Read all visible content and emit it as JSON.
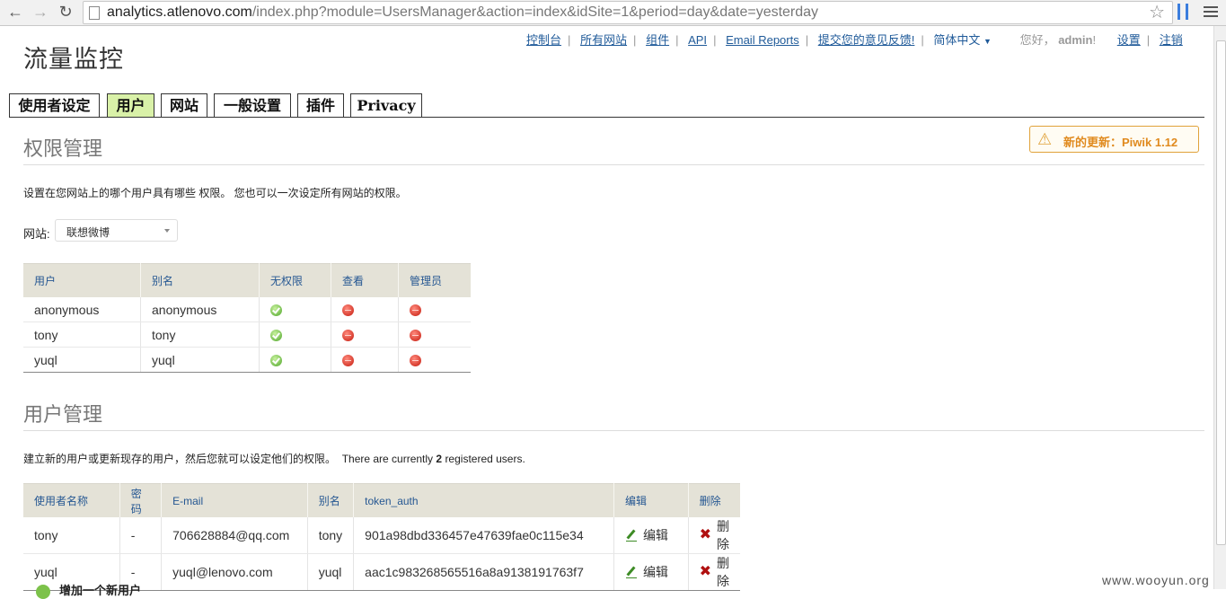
{
  "browser": {
    "back_icon": "back-arrow-icon",
    "forward_icon": "forward-arrow-icon",
    "reload_icon": "reload-icon",
    "url_host": "analytics.atlenovo.com",
    "url_path": "/index.php?module=UsersManager&action=index&idSite=1&period=day&date=yesterday"
  },
  "header": {
    "logo": "流量监控",
    "nav": [
      "控制台",
      "所有网站",
      "组件",
      "API",
      "Email Reports",
      "提交您的意见反馈!"
    ],
    "language": "简体中文",
    "greeting_prefix": "您好，",
    "username": "admin",
    "greeting_suffix": "!",
    "settings": "设置",
    "logout": "注销"
  },
  "tabs": [
    {
      "label": "使用者设定",
      "active": false
    },
    {
      "label": "用户",
      "active": true
    },
    {
      "label": "网站",
      "active": false
    },
    {
      "label": "一般设置",
      "active": false
    },
    {
      "label": "插件",
      "active": false
    },
    {
      "label": "Privacy",
      "active": false
    }
  ],
  "update_notice": "新的更新：Piwik 1.12",
  "permissions": {
    "title": "权限管理",
    "description": "设置在您网站上的哪个用户具有哪些 权限。 您也可以一次设定所有网站的权限。",
    "site_label": "网站:",
    "site_value": "联想微博",
    "headers": [
      "用户",
      "别名",
      "无权限",
      "查看",
      "管理员"
    ],
    "rows": [
      {
        "user": "anonymous",
        "alias": "anonymous",
        "noaccess": true,
        "view": false,
        "admin": false
      },
      {
        "user": "tony",
        "alias": "tony",
        "noaccess": true,
        "view": false,
        "admin": false
      },
      {
        "user": "yuql",
        "alias": "yuql",
        "noaccess": true,
        "view": false,
        "admin": false
      }
    ]
  },
  "user_mgmt": {
    "title": "用户管理",
    "description_cn": "建立新的用户或更新现存的用户，然后您就可以设定他们的权限。",
    "description_en_pre": "There are currently",
    "user_count": "2",
    "description_en_post": "registered users.",
    "headers": [
      "使用者名称",
      "密码",
      "E-mail",
      "别名",
      "token_auth",
      "编辑",
      "删除"
    ],
    "rows": [
      {
        "login": "tony",
        "password": "-",
        "email": "706628884@qq.com",
        "alias": "tony",
        "token": "901a98dbd336457e47639fae0c115e34",
        "edit": "编辑",
        "delete": "删除"
      },
      {
        "login": "yuql",
        "password": "-",
        "email": "yuql@lenovo.com",
        "alias": "yuql",
        "token": "aac1c983268565516a8a9138191763f7",
        "edit": "编辑",
        "delete": "删除"
      }
    ],
    "add_new": "增加一个新用户"
  },
  "watermark": "www.wooyun.org",
  "colors": {
    "active_tab": "#d9f1a8",
    "link": "#1f5a99",
    "warning": "#e0a23a",
    "table_header": "#e4e2d7"
  }
}
